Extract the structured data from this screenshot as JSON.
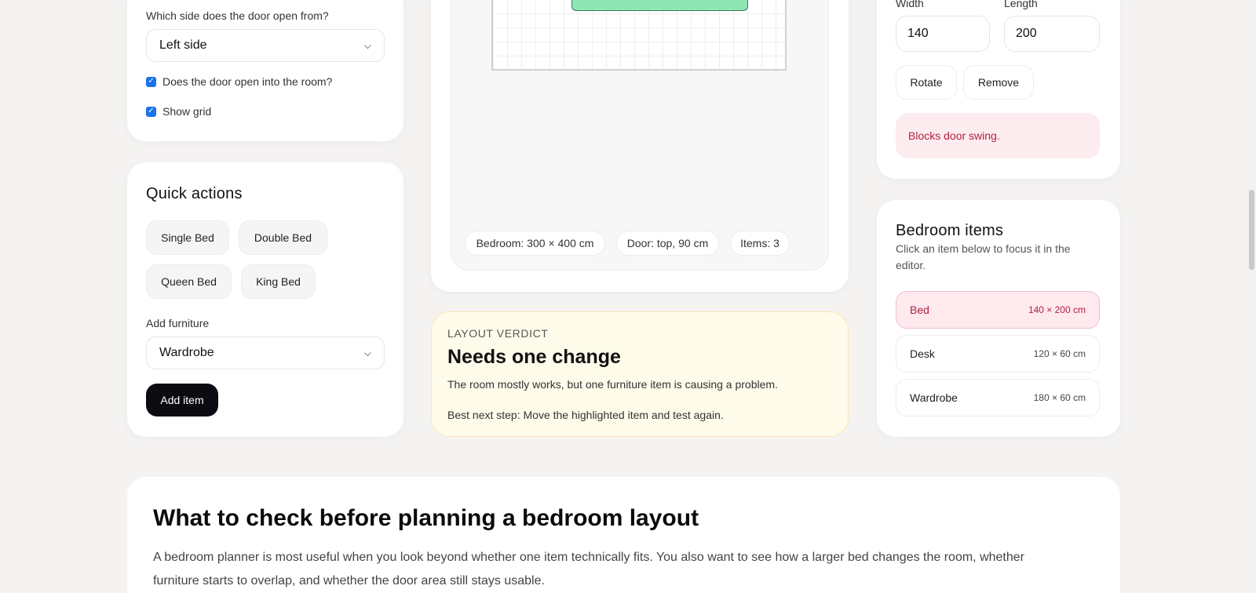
{
  "door_settings": {
    "side_label": "Which side does the door open from?",
    "side_value": "Left side",
    "opens_into_label": "Does the door open into the room?",
    "show_grid_label": "Show grid"
  },
  "quick_actions": {
    "title": "Quick actions",
    "presets": [
      "Single Bed",
      "Double Bed",
      "Queen Bed",
      "King Bed"
    ],
    "add_furniture_label": "Add furniture",
    "add_furniture_value": "Wardrobe",
    "add_button": "Add item"
  },
  "canvas": {
    "chips": [
      "Bedroom: 300 × 400 cm",
      "Door: top, 90 cm",
      "Items: 3"
    ],
    "bed_color": "#8fe6b5"
  },
  "verdict": {
    "kicker": "LAYOUT VERDICT",
    "title": "Needs one change",
    "description": "The room mostly works, but one furniture item is causing a problem.",
    "next_step": "Best next step: Move the highlighted item and test again."
  },
  "item_editor": {
    "width_label": "Width",
    "length_label": "Length",
    "width_value": "140",
    "length_value": "200",
    "rotate_button": "Rotate",
    "remove_button": "Remove",
    "warning": "Blocks door swing."
  },
  "bedroom_items": {
    "title": "Bedroom items",
    "subtitle_line1": "Click an item below to focus it in the",
    "subtitle_line2": "editor.",
    "items": [
      {
        "name": "Bed",
        "size": "140 × 200 cm"
      },
      {
        "name": "Desk",
        "size": "120 × 60 cm"
      },
      {
        "name": "Wardrobe",
        "size": "180 × 60 cm"
      }
    ]
  },
  "article": {
    "title": "What to check before planning a bedroom layout",
    "line1": "A bedroom planner is most useful when you look beyond whether one item technically fits. You also want to see how a larger bed changes the room, whether",
    "line2": "furniture starts to overlap, and whether the door area still stays usable."
  },
  "colors": {
    "accent_dark": "#0b0b12",
    "warning_text": "#b2203f",
    "warning_bg": "#fdecef",
    "verdict_bg": "#fffbea"
  }
}
